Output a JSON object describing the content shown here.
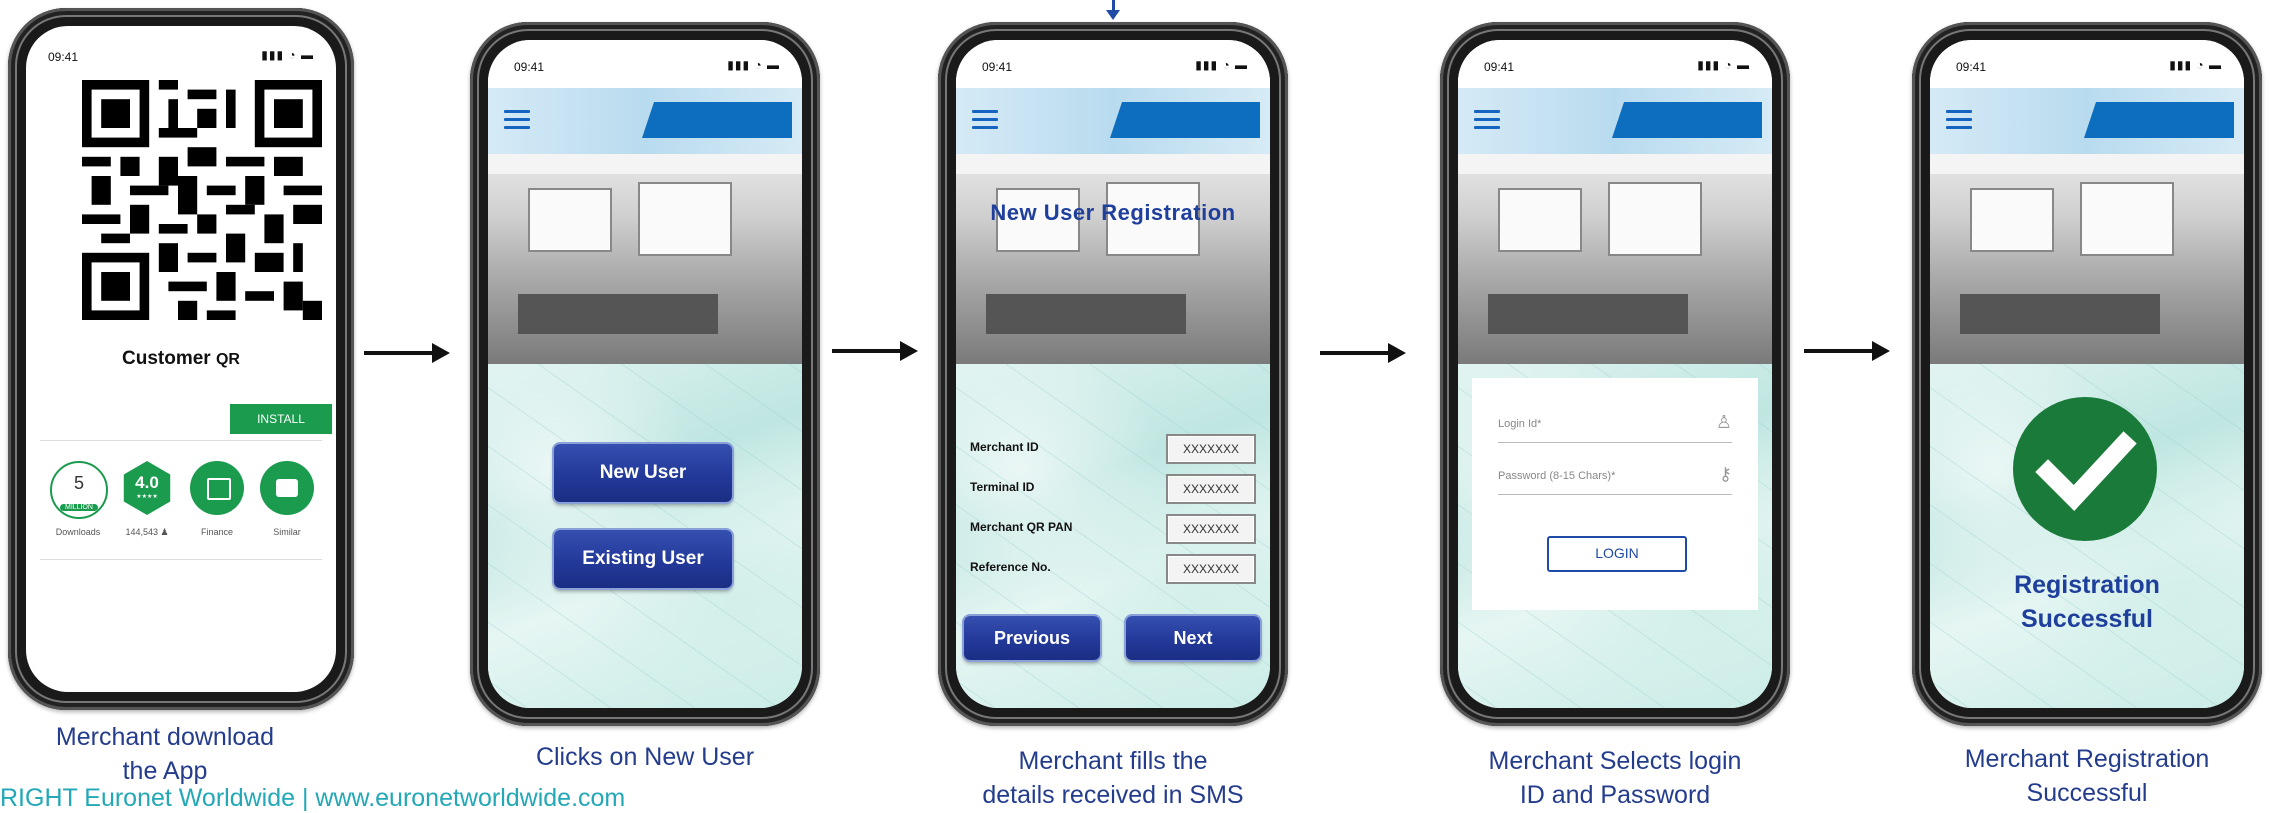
{
  "status_time": "09:41",
  "step1": {
    "qr_label_a": "Customer",
    "qr_label_b": "QR",
    "install_label": "INSTALL",
    "stat1_value": "5",
    "stat1_unit": "MILLION",
    "stat1_label": "Downloads",
    "stat2_value": "4.0",
    "stat2_stars": "★★★★",
    "stat2_label": "144,543 ♟",
    "stat3_label": "Finance",
    "stat4_label": "Similar",
    "caption_line1": "Merchant download",
    "caption_line2": "the App",
    "accent": "#1a9b4e"
  },
  "step2": {
    "new_user_label": "New User",
    "existing_user_label": "Existing User",
    "caption": "Clicks on New User"
  },
  "step3": {
    "title": "New User Registration",
    "fields": [
      {
        "label": "Merchant  ID",
        "value": "XXXXXXX"
      },
      {
        "label": "Terminal  ID",
        "value": "XXXXXXX"
      },
      {
        "label": "Merchant  QR PAN",
        "value": "XXXXXXX"
      },
      {
        "label": "Reference   No.",
        "value": "XXXXXXX"
      }
    ],
    "previous_label": "Previous",
    "next_label": "Next",
    "caption_line1": "Merchant fills the",
    "caption_line2": "details received in SMS"
  },
  "step4": {
    "login_placeholder": "Login Id*",
    "password_placeholder": "Password (8-15 Chars)*",
    "login_button": "LOGIN",
    "caption_line1": "Merchant Selects login",
    "caption_line2": "ID and Password"
  },
  "step5": {
    "message_line1": "Registration",
    "message_line2": "Successful",
    "caption_line1": "Merchant Registration",
    "caption_line2": "Successful",
    "check_color": "#1a7a3a"
  },
  "footer_text": "RIGHT Euronet Worldwide | www.euronetworldwide.com",
  "colors": {
    "caption": "#243c8c",
    "button_blue": "#23399a",
    "footer": "#22a8b6"
  }
}
